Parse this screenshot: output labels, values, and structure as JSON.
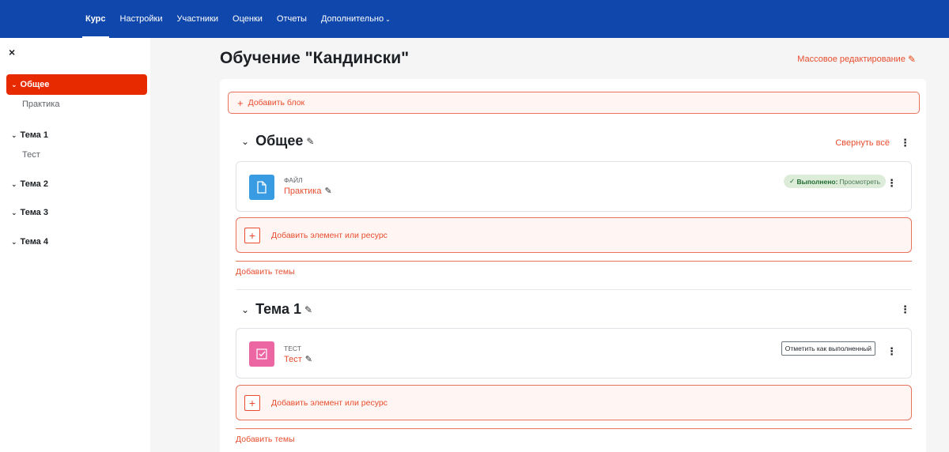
{
  "nav": {
    "tabs": [
      {
        "label": "Курс",
        "active": true
      },
      {
        "label": "Настройки"
      },
      {
        "label": "Участники"
      },
      {
        "label": "Оценки"
      },
      {
        "label": "Отчеты"
      },
      {
        "label": "Дополнительно"
      }
    ]
  },
  "sidebar": {
    "close": "×",
    "sections": [
      {
        "label": "Общее",
        "active": true,
        "items": [
          "Практика"
        ]
      },
      {
        "label": "Тема 1",
        "items": [
          "Тест"
        ]
      },
      {
        "label": "Тема 2",
        "items": []
      },
      {
        "label": "Тема 3",
        "items": []
      },
      {
        "label": "Тема 4",
        "items": []
      }
    ]
  },
  "course": {
    "title": "Обучение \"Кандински\"",
    "bulk_edit": "Массовое редактирование",
    "add_block": "Добавить блок",
    "collapse_all": "Свернуть всё"
  },
  "sections": [
    {
      "title": "Общее",
      "activity": {
        "type": "ФАЙЛ",
        "name": "Практика",
        "icon": "file-icon",
        "icon_color": "#399be2",
        "status_bold": "Выполнено:",
        "status_text": "Просмотреть"
      },
      "add_resource": "Добавить элемент или ресурс",
      "add_topics": "Добавить темы"
    },
    {
      "title": "Тема 1",
      "activity": {
        "type": "ТЕСТ",
        "name": "Тест",
        "icon": "quiz-icon",
        "icon_color": "#eb66a2",
        "mark_done": "Отметить как выполненный"
      },
      "add_resource": "Добавить элемент или ресурс",
      "add_topics": "Добавить темы"
    }
  ],
  "colors": {
    "brand": "#0f47ad",
    "accent": "#e84d2f",
    "active_section": "#e82a00"
  }
}
